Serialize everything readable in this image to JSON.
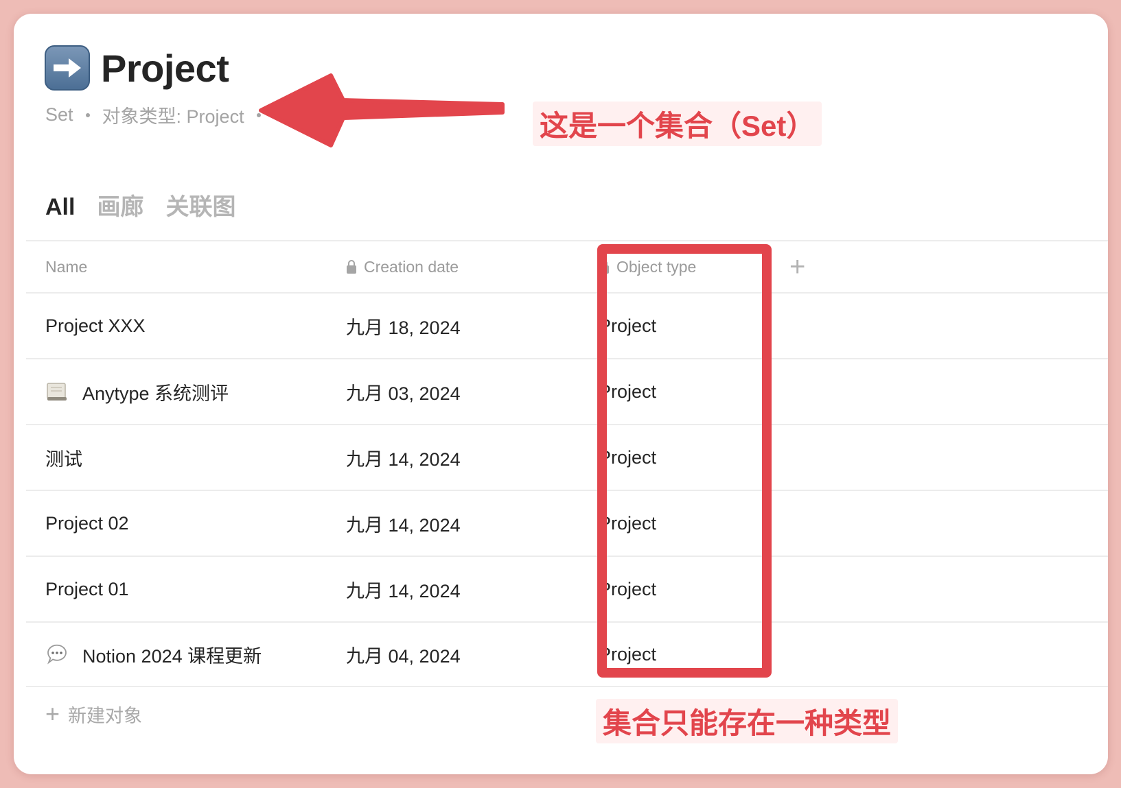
{
  "page": {
    "title": "Project",
    "title_icon": "right-arrow-icon",
    "meta": {
      "kind": "Set",
      "object_type_label": "对象类型: Project"
    }
  },
  "tabs": [
    {
      "label": "All",
      "active": true
    },
    {
      "label": "画廊",
      "active": false
    },
    {
      "label": "关联图",
      "active": false
    }
  ],
  "table": {
    "columns": {
      "name": "Name",
      "creation_date": "Creation date",
      "object_type": "Object type"
    },
    "rows": [
      {
        "name": "Project XXX",
        "icon": "",
        "date": "九月 18, 2024",
        "type": "Project"
      },
      {
        "name": "Anytype 系统测评",
        "icon": "scroll-icon",
        "date": "九月 03, 2024",
        "type": "Project"
      },
      {
        "name": "测试",
        "icon": "",
        "date": "九月 14, 2024",
        "type": "Project"
      },
      {
        "name": "Project 02",
        "icon": "",
        "date": "九月 14, 2024",
        "type": "Project"
      },
      {
        "name": "Project 01",
        "icon": "",
        "date": "九月 14, 2024",
        "type": "Project"
      },
      {
        "name": "Notion 2024 课程更新",
        "icon": "speech-bubble-icon",
        "date": "九月 04, 2024",
        "type": "Project"
      }
    ],
    "new_object_label": "新建对象"
  },
  "annotations": {
    "callout_set": "这是一个集合（Set）",
    "callout_single_type": "集合只能存在一种类型",
    "accent_color": "#e2454c"
  }
}
